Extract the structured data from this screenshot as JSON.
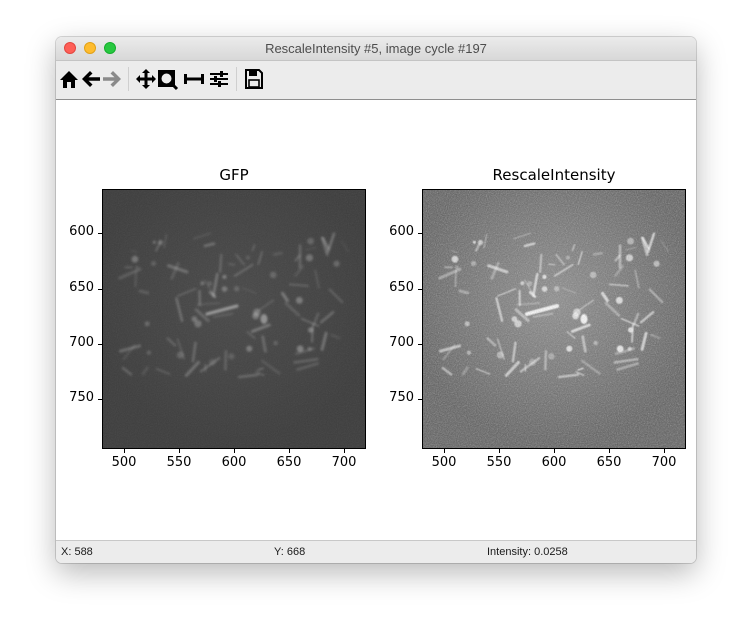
{
  "window": {
    "title": "RescaleIntensity #5, image cycle #197"
  },
  "toolbar": {
    "buttons": [
      {
        "name": "home-icon"
      },
      {
        "name": "back-icon"
      },
      {
        "name": "forward-icon"
      },
      {
        "name": "pan-icon"
      },
      {
        "name": "zoom-icon"
      },
      {
        "name": "subplots-icon"
      },
      {
        "name": "configure-icon"
      },
      {
        "name": "save-icon"
      }
    ]
  },
  "plots": [
    {
      "title": "GFP",
      "x_ticks": [
        "500",
        "550",
        "600",
        "650",
        "700"
      ],
      "y_ticks": [
        "600",
        "650",
        "700",
        "750"
      ],
      "brightness": "dim"
    },
    {
      "title": "RescaleIntensity",
      "x_ticks": [
        "500",
        "550",
        "600",
        "650",
        "700"
      ],
      "y_ticks": [
        "600",
        "650",
        "700",
        "750"
      ],
      "brightness": "bright"
    }
  ],
  "axes": {
    "xlim": [
      480,
      720
    ],
    "ylim": [
      795,
      560
    ]
  },
  "status": {
    "x": "X: 588",
    "y": "Y: 668",
    "intensity": "Intensity: 0.0258"
  },
  "colors": {
    "close": "#fe5f57",
    "minimize": "#febc2e",
    "maximize": "#28c840"
  }
}
